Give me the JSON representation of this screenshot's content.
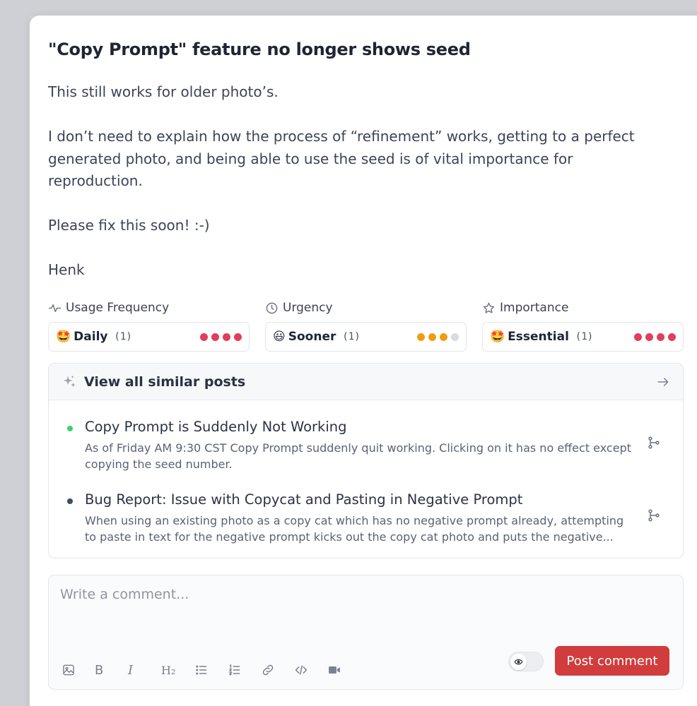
{
  "post": {
    "title": "\"Copy Prompt\" feature no longer shows seed",
    "paragraphs": [
      "This still works for older photo’s.",
      "I don’t need to explain how the process of “refinement” works, getting to a perfect generated photo, and being able to use the seed is of vital importance for reproduction.",
      "Please fix this soon! :-)",
      "Henk"
    ]
  },
  "metrics": [
    {
      "label": "Usage Frequency",
      "icon": "activity-icon",
      "emoji": "🤩",
      "value": "Daily",
      "count": "(1)",
      "level": 4,
      "max": 4,
      "color": "#e23d5b"
    },
    {
      "label": "Urgency",
      "icon": "clock-icon",
      "emoji": "😃",
      "value": "Sooner",
      "count": "(1)",
      "level": 3,
      "max": 4,
      "color": "#ef9d12"
    },
    {
      "label": "Importance",
      "icon": "star-icon",
      "emoji": "🤩",
      "value": "Essential",
      "count": "(1)",
      "level": 4,
      "max": 4,
      "color": "#e23d5b"
    }
  ],
  "similar": {
    "header": "View all similar posts",
    "posts": [
      {
        "title": "Copy Prompt is Suddenly Not Working",
        "description": "As of Friday AM 9:30 CST Copy Prompt suddenly quit working. Clicking on it has no effect except copying the seed number.",
        "status_color": "#3fcf6f"
      },
      {
        "title": "Bug Report: Issue with Copycat and Pasting in Negative Prompt",
        "description": "When using an existing photo as a copy cat which has no negative prompt already, attempting to paste in text for the negative prompt kicks out the copy cat photo and puts the negative...",
        "status_color": "#3e4a66"
      }
    ]
  },
  "comment": {
    "placeholder": "Write a comment...",
    "submit_label": "Post comment",
    "toolbar": {
      "bold": "B",
      "italic": "I",
      "heading": "H₂"
    }
  }
}
